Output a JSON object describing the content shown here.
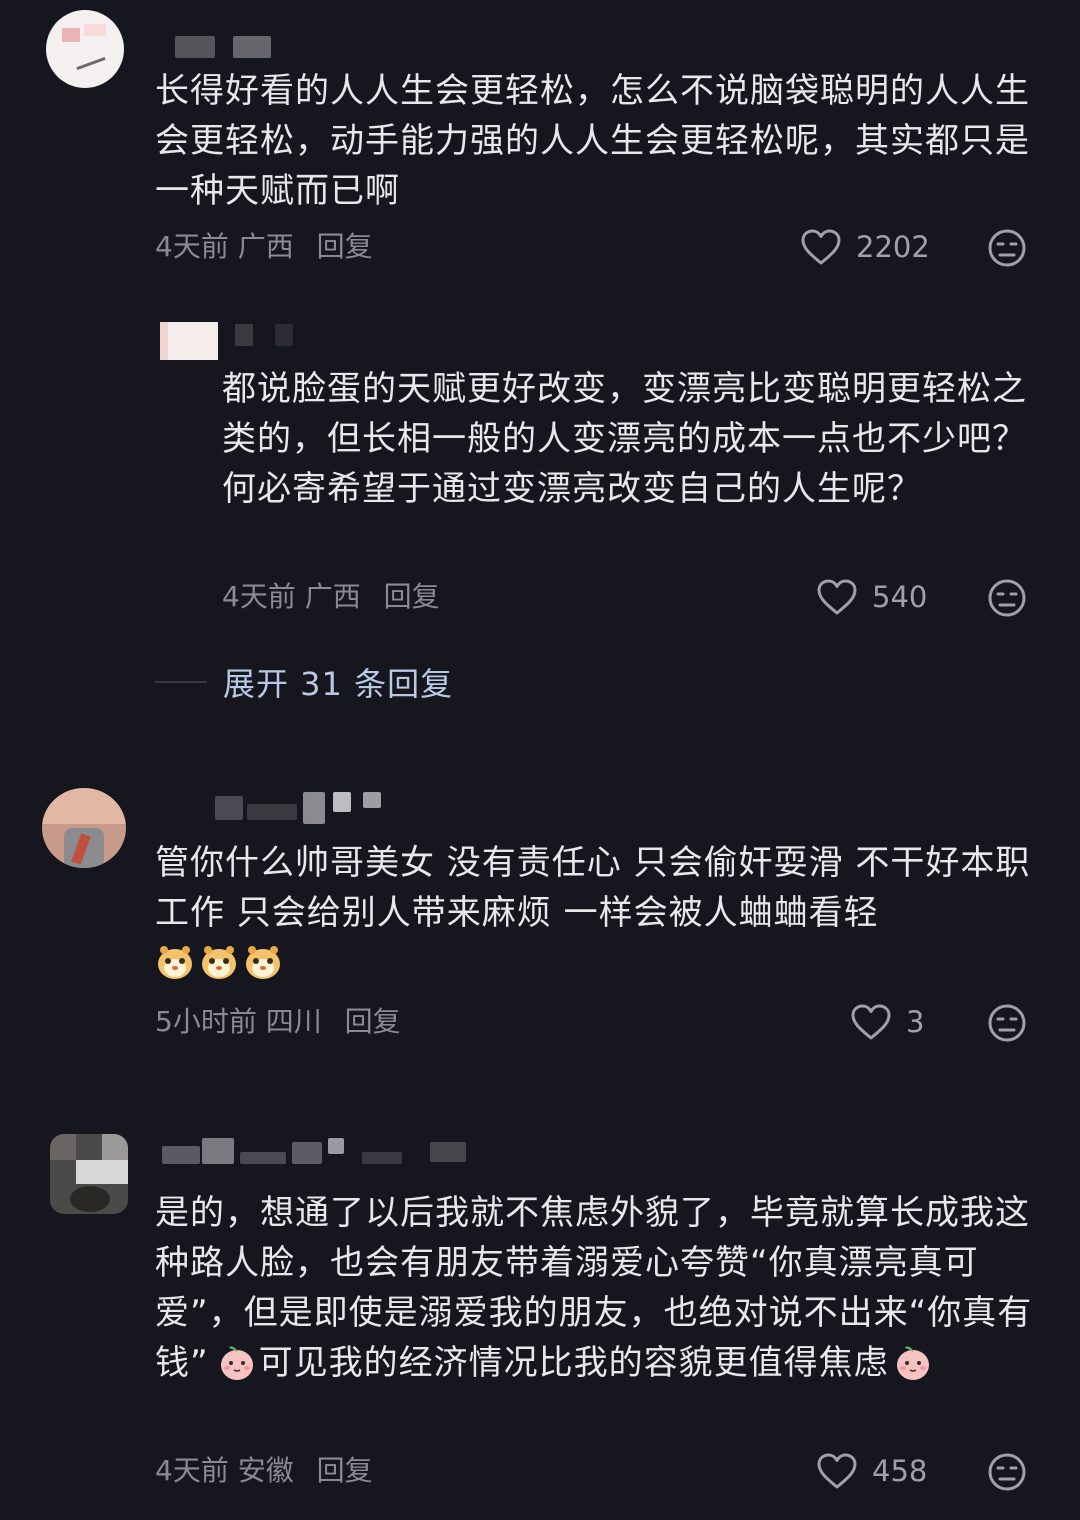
{
  "comments": [
    {
      "text": "长得好看的人人生会更轻松，怎么不说脑袋聪明的人人生会更轻松，动手能力强的人人生会更轻松呢，其实都只是一种天赋而已啊",
      "time": "4天前",
      "location": "广西",
      "reply_label": "回复",
      "likes": "2202"
    },
    {
      "text": "都说脸蛋的天赋更好改变，变漂亮比变聪明更轻松之类的，但长相一般的人变漂亮的成本一点也不少吧？何必寄希望于通过变漂亮改变自己的人生呢？",
      "time": "4天前",
      "location": "广西",
      "reply_label": "回复",
      "likes": "540"
    },
    {
      "text": "管你什么帅哥美女 没有责任心 只会偷奸耍滑 不干好本职工作 只会给别人带来麻烦 一样会被人蛐蛐看轻",
      "time": "5小时前",
      "location": "四川",
      "reply_label": "回复",
      "likes": "3",
      "emojis": [
        "hamster-emoji",
        "hamster-emoji",
        "hamster-emoji"
      ]
    },
    {
      "text_1": "是的，想通了以后我就不焦虑外貌了，毕竟就算长成我这种路人脸，也会有朋友带着溺爱心夸赞“你真漂亮真可爱”，但是即使是溺爱我的朋友，也绝对说不出来“你真有钱”",
      "text_2": "可见我的经济情况比我的容貌更值得焦虑",
      "time": "4天前",
      "location": "安徽",
      "reply_label": "回复",
      "likes": "458",
      "emojis": [
        "peach-face-emoji",
        "peach-face-emoji"
      ]
    }
  ],
  "expand_replies": "展开 31 条回复",
  "colors": {
    "background": "#16161e",
    "text": "#e8e8ea",
    "meta": "#8a8a92",
    "link": "#b9c8e4"
  }
}
